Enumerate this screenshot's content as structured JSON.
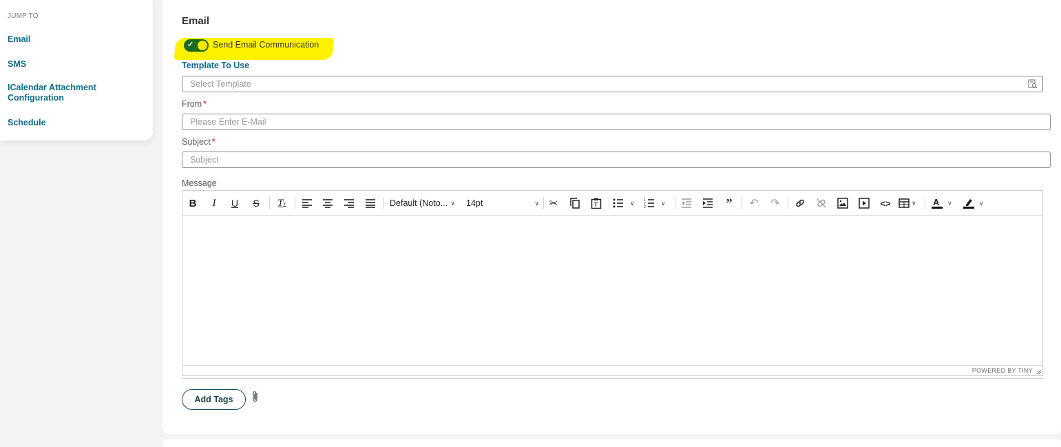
{
  "sidebar": {
    "heading": "JUMP TO",
    "items": [
      {
        "label": "Email"
      },
      {
        "label": "SMS"
      },
      {
        "label": "ICalendar Attachment Configuration"
      },
      {
        "label": "Schedule"
      }
    ]
  },
  "email": {
    "title": "Email",
    "toggle": {
      "label": "Send Email Communication",
      "checked": true
    },
    "template": {
      "label": "Template To Use",
      "placeholder": "Select Template"
    },
    "from": {
      "label": "From",
      "required_mark": "*",
      "placeholder": "Please Enter E-Mail"
    },
    "subject": {
      "label": "Subject",
      "required_mark": "*",
      "placeholder": "Subject"
    },
    "message": {
      "label": "Message",
      "font_family": "Default (Noto...",
      "font_size": "14pt",
      "powered_by": "POWERED BY TINY"
    },
    "add_tags_label": "Add Tags"
  },
  "colors": {
    "accent": "#0f6b8a",
    "toggle_on": "#1d6b1f",
    "highlight": "#fff200",
    "required": "#cc0000"
  }
}
